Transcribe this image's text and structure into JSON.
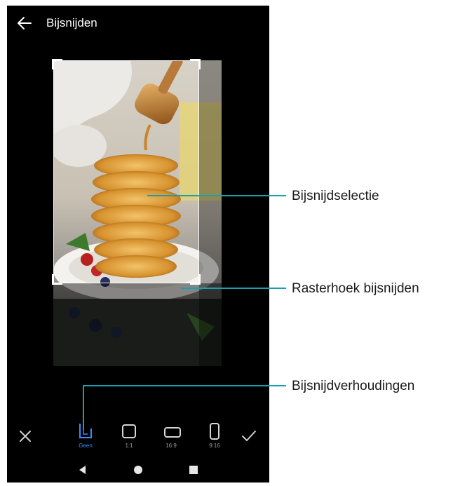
{
  "screen": {
    "title": "Bijsnijden",
    "icons": {
      "back": "back-arrow-icon",
      "cancel": "close-icon",
      "confirm": "checkmark-icon"
    }
  },
  "ratio_options": [
    {
      "label": "Geen",
      "icon": "free-crop-icon",
      "active": true
    },
    {
      "label": "1:1",
      "icon": "square-ratio-icon",
      "active": false
    },
    {
      "label": "16:9",
      "icon": "landscape-ratio-icon",
      "active": false
    },
    {
      "label": "9:16",
      "icon": "portrait-ratio-icon",
      "active": false
    }
  ],
  "navbar": {
    "icons": [
      "nav-back-icon",
      "nav-home-icon",
      "nav-recents-icon"
    ]
  },
  "callouts": {
    "selection": "Bijsnijdselectie",
    "corner": "Rasterhoek bijsnijden",
    "ratios": "Bijsnijdverhoudingen"
  },
  "colors": {
    "accent": "#3d8bff",
    "callout_line": "#1a9fb0",
    "background": "#000000"
  }
}
